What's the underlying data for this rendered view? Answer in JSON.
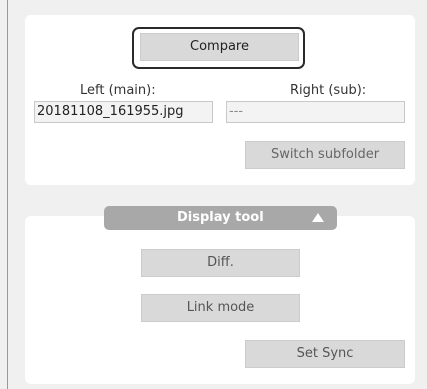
{
  "compare": {
    "label": "Compare"
  },
  "files": {
    "left_label": "Left (main):",
    "right_label": "Right (sub):",
    "left_value": "20181108_161955.jpg",
    "right_value": "---"
  },
  "switch_subfolder": {
    "label": "Switch subfolder"
  },
  "display_tool": {
    "label": "Display tool",
    "collapse_icon": "triangle-up-icon",
    "diff_label": "Diff.",
    "link_mode_label": "Link mode",
    "set_sync_label": "Set Sync"
  },
  "colors": {
    "background": "#f0f0f0",
    "panel": "#ffffff",
    "button": "#d9d9d9",
    "header": "#a8a8a8",
    "focus_outline": "#2a2a2a"
  }
}
